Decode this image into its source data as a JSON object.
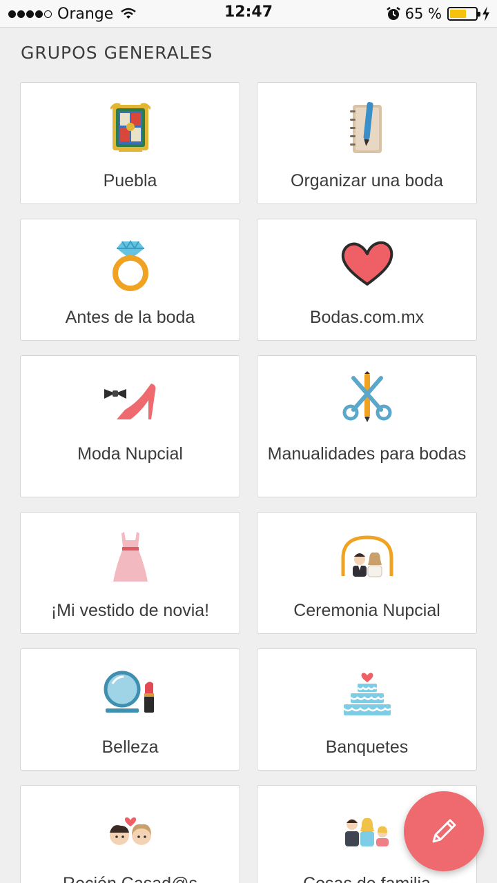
{
  "status_bar": {
    "carrier": "Orange",
    "time": "12:47",
    "battery_percent": "65 %",
    "battery_level": 0.65,
    "signal_bars": 4,
    "icons": [
      "signal-dots-icon",
      "wifi-icon",
      "alarm-icon",
      "battery-icon",
      "charging-icon"
    ]
  },
  "section": {
    "title": "GRUPOS GENERALES"
  },
  "groups": [
    {
      "label": "Puebla",
      "icon": "puebla-coat-of-arms-icon"
    },
    {
      "label": "Organizar una boda",
      "icon": "notebook-pen-icon"
    },
    {
      "label": "Antes de la boda",
      "icon": "diamond-ring-icon"
    },
    {
      "label": "Bodas.com.mx",
      "icon": "heart-icon"
    },
    {
      "label": "Moda Nupcial",
      "icon": "bowtie-heel-icon"
    },
    {
      "label": "Manualidades para bodas",
      "icon": "scissors-pencil-icon"
    },
    {
      "label": "¡Mi vestido de novia!",
      "icon": "wedding-dress-icon"
    },
    {
      "label": "Ceremonia Nupcial",
      "icon": "couple-arch-icon"
    },
    {
      "label": "Belleza",
      "icon": "mirror-lipstick-icon"
    },
    {
      "label": "Banquetes",
      "icon": "wedding-cake-icon"
    },
    {
      "label": "Recién Casad@s",
      "icon": "newlyweds-icon"
    },
    {
      "label": "Cosas de familia",
      "icon": "family-icon"
    }
  ],
  "fab": {
    "icon": "pencil-icon"
  }
}
